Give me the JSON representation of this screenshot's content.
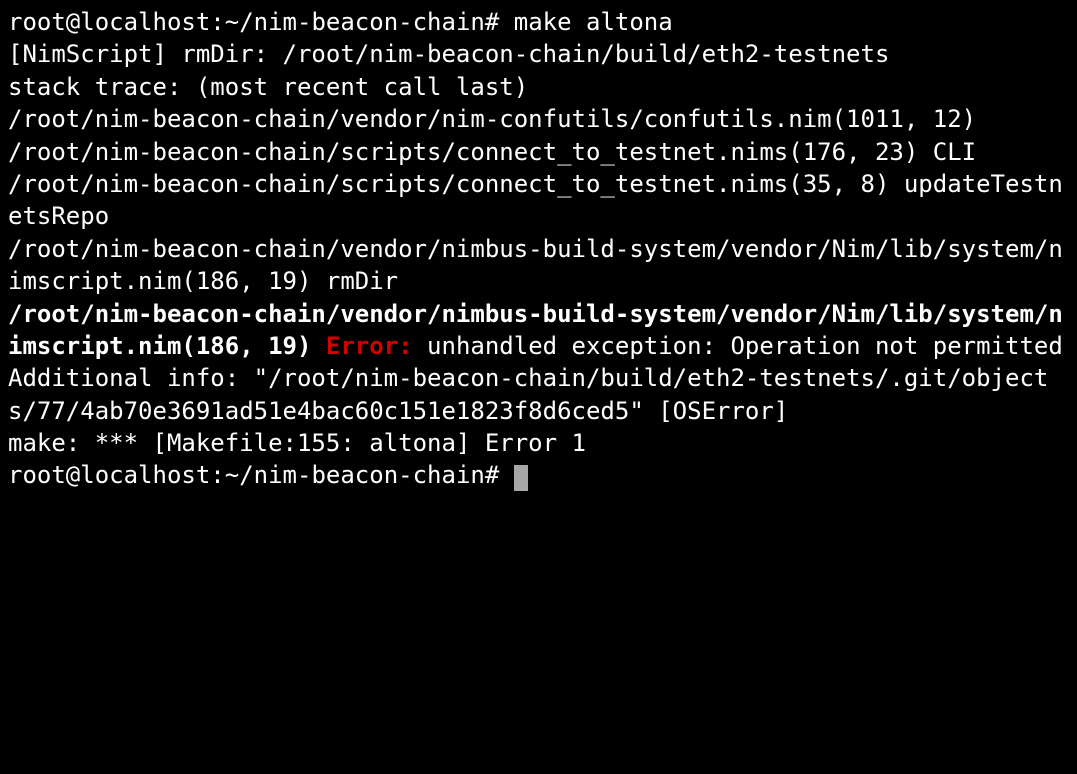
{
  "prompt": {
    "user_host": "root@localhost",
    "sep": ":",
    "cwd": "~/nim-beacon-chain",
    "symbol": "#"
  },
  "command": "make altona",
  "lines": {
    "nimscript_rmdir": "[NimScript] rmDir: /root/nim-beacon-chain/build/eth2-testnets",
    "stack_trace": "stack trace: (most recent call last)",
    "confutils": "/root/nim-beacon-chain/vendor/nim-confutils/confutils.nim(1011, 12)",
    "connect1": "/root/nim-beacon-chain/scripts/connect_to_testnet.nims(176, 23) CLI",
    "connect2": "/root/nim-beacon-chain/scripts/connect_to_testnet.nims(35, 8) updateTestnetsRepo",
    "nimscript1": "/root/nim-beacon-chain/vendor/nimbus-build-system/vendor/Nim/lib/system/nimscript.nim(186, 19) rmDir",
    "nimscript2_bold": "/root/nim-beacon-chain/vendor/nimbus-build-system/vendor/Nim/lib/system/nimscript.nim(186, 19) ",
    "error_label": "Error:",
    "error_tail": " unhandled exception: Operation not permitted",
    "additional_info": "Additional info: \"/root/nim-beacon-chain/build/eth2-testnets/.git/objects/77/4ab70e3691ad51e4bac60c151e1823f8d6ced5\" [OSError]",
    "make_error": "make: *** [Makefile:155: altona] Error 1"
  }
}
